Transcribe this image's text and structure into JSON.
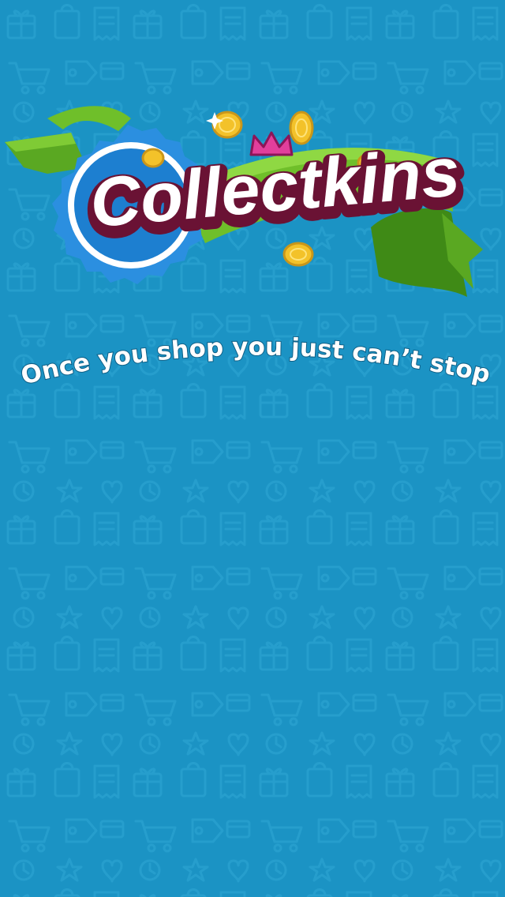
{
  "logo": {
    "word": "Collectkins",
    "icon": "crown-icon"
  },
  "tagline": {
    "text": "Once you shop you just can’t stop"
  },
  "colors": {
    "background": "#1b93c4",
    "pattern_line": "#2aa2d2",
    "ribbon_green": "#6fbf2a",
    "ribbon_green_dark": "#3f8a16",
    "badge_blue": "#2b8fe0",
    "logo_text": "#ffffff",
    "logo_outline": "#6a1234",
    "crown": "#e23f9c",
    "coin": "#f3c22a"
  }
}
